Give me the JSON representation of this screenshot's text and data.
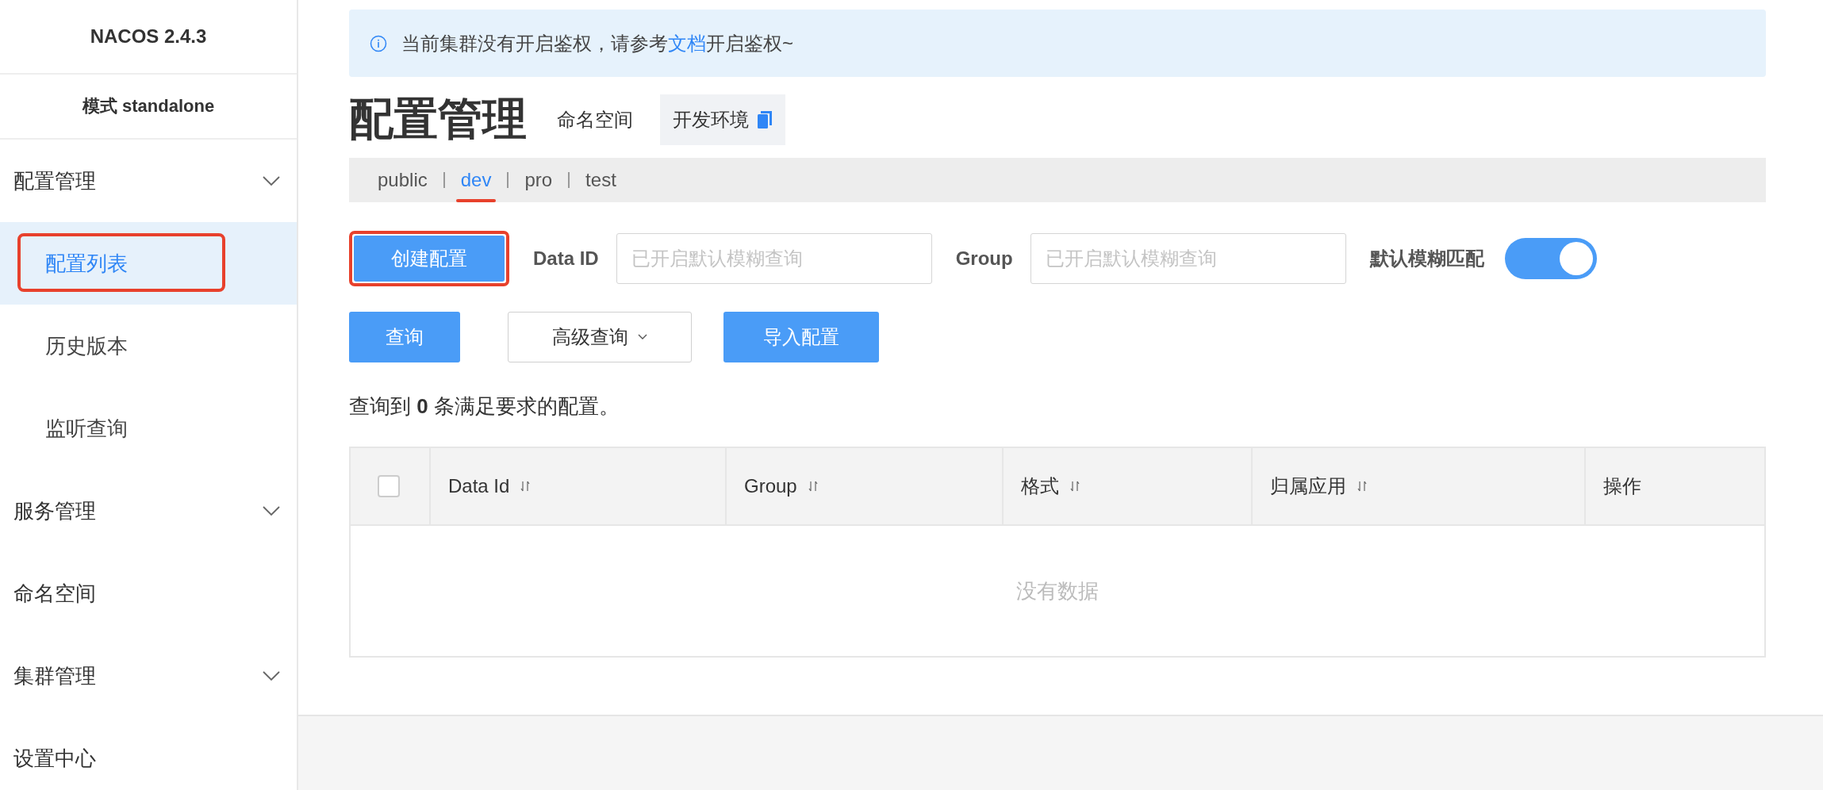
{
  "sidebar": {
    "title": "NACOS 2.4.3",
    "mode": "模式 standalone",
    "items": [
      {
        "label": "配置管理",
        "kind": "group",
        "children": [
          {
            "label": "配置列表",
            "selected": true,
            "annotated": true
          },
          {
            "label": "历史版本",
            "selected": false,
            "annotated": false
          },
          {
            "label": "监听查询",
            "selected": false,
            "annotated": false
          }
        ]
      },
      {
        "label": "服务管理",
        "kind": "group"
      },
      {
        "label": "命名空间",
        "kind": "link"
      },
      {
        "label": "集群管理",
        "kind": "group"
      },
      {
        "label": "设置中心",
        "kind": "link"
      }
    ]
  },
  "notice": {
    "before": "当前集群没有开启鉴权，请参考",
    "link": "文档",
    "after": "开启鉴权~"
  },
  "page_title": "配置管理",
  "namespace": {
    "label": "命名空间",
    "value": "开发环境"
  },
  "namespaces": [
    {
      "label": "public",
      "selected": false,
      "annotated": false
    },
    {
      "label": "dev",
      "selected": true,
      "annotated": true
    },
    {
      "label": "pro",
      "selected": false,
      "annotated": false
    },
    {
      "label": "test",
      "selected": false,
      "annotated": false
    }
  ],
  "create_button": {
    "label": "创建配置",
    "annotated": true
  },
  "fields": [
    {
      "label": "Data ID",
      "placeholder": "已开启默认模糊查询"
    },
    {
      "label": "Group",
      "placeholder": "已开启默认模糊查询"
    }
  ],
  "fuzzy_match": {
    "label": "默认模糊匹配",
    "on": true
  },
  "query_button": "查询",
  "advanced_button": "高级查询",
  "import_button": "导入配置",
  "summary": "查询到 **0** 条满足要求的配置。",
  "table": {
    "select_all_checked": false,
    "columns": [
      {
        "label": "Data Id",
        "sortable": true
      },
      {
        "label": "Group",
        "sortable": true
      },
      {
        "label": "格式",
        "sortable": true
      },
      {
        "label": "归属应用",
        "sortable": true
      },
      {
        "label": "操作",
        "sortable": false
      }
    ],
    "empty_text": "没有数据"
  }
}
